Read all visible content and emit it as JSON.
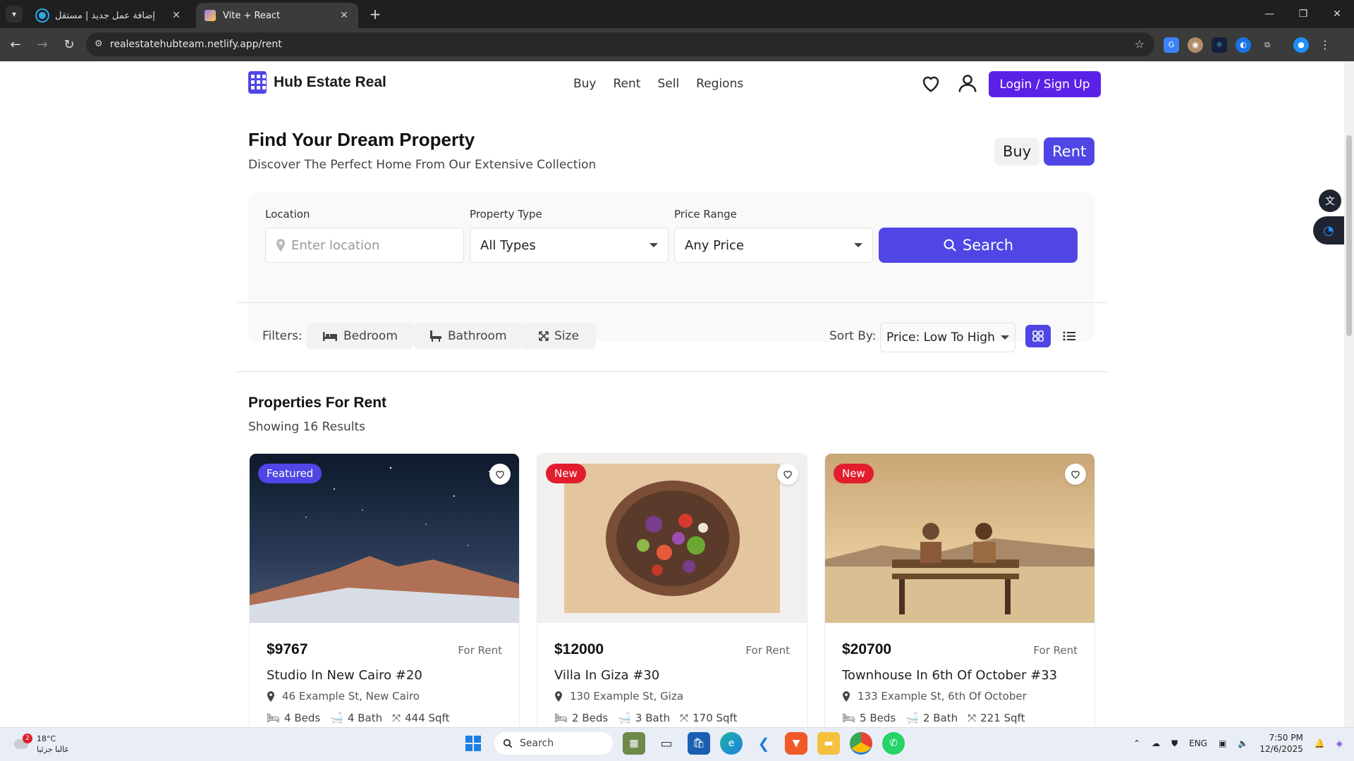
{
  "browser": {
    "tabs": [
      {
        "title": "إضافة عمل جديد | مستقل",
        "active": false
      },
      {
        "title": "Vite + React",
        "active": true
      }
    ],
    "url": "realestatehubteam.netlify.app/rent"
  },
  "header": {
    "brand": "Hub Estate Real",
    "nav": [
      "Buy",
      "Rent",
      "Sell",
      "Regions"
    ],
    "login_label": "Login / Sign Up"
  },
  "hero": {
    "title": "Find Your Dream Property",
    "subtitle": "Discover The Perfect Home From Our Extensive Collection",
    "toggle": {
      "buy": "Buy",
      "rent": "Rent",
      "active": "Rent"
    }
  },
  "search": {
    "location_label": "Location",
    "location_placeholder": "Enter location",
    "type_label": "Property Type",
    "type_value": "All Types",
    "price_label": "Price Range",
    "price_value": "Any Price",
    "button": "Search"
  },
  "filters": {
    "label": "Filters:",
    "chips": [
      "Bedroom",
      "Bathroom",
      "Size"
    ],
    "sort_label": "Sort By:",
    "sort_value": "Price: Low To High",
    "view": "grid"
  },
  "results": {
    "title": "Properties For Rent",
    "count_text": "Showing 16 Results",
    "cards": [
      {
        "badge": "Featured",
        "price": "$9767",
        "status": "For Rent",
        "title": "Studio In New Cairo #20",
        "address": "46 Example St, New Cairo",
        "beds": "4 Beds",
        "baths": "4 Bath",
        "size": "444 Sqft"
      },
      {
        "badge": "New",
        "price": "$12000",
        "status": "For Rent",
        "title": "Villa In Giza #30",
        "address": "130 Example St, Giza",
        "beds": "2 Beds",
        "baths": "3 Bath",
        "size": "170 Sqft"
      },
      {
        "badge": "New",
        "price": "$20700",
        "status": "For Rent",
        "title": "Townhouse In 6th Of October #33",
        "address": "133 Example St, 6th Of October",
        "beds": "5 Beds",
        "baths": "2 Bath",
        "size": "221 Sqft"
      }
    ]
  },
  "taskbar": {
    "weather_temp": "18°C",
    "weather_desc": "غالبا جزئيا",
    "weather_badge": "2",
    "search_placeholder": "Search",
    "lang": "ENG",
    "time": "7:50 PM",
    "date": "12/6/2025"
  },
  "colors": {
    "accent": "#4f46e5",
    "login": "#5b21e6",
    "featured": "#4f46e5",
    "new": "#e11d2e"
  }
}
